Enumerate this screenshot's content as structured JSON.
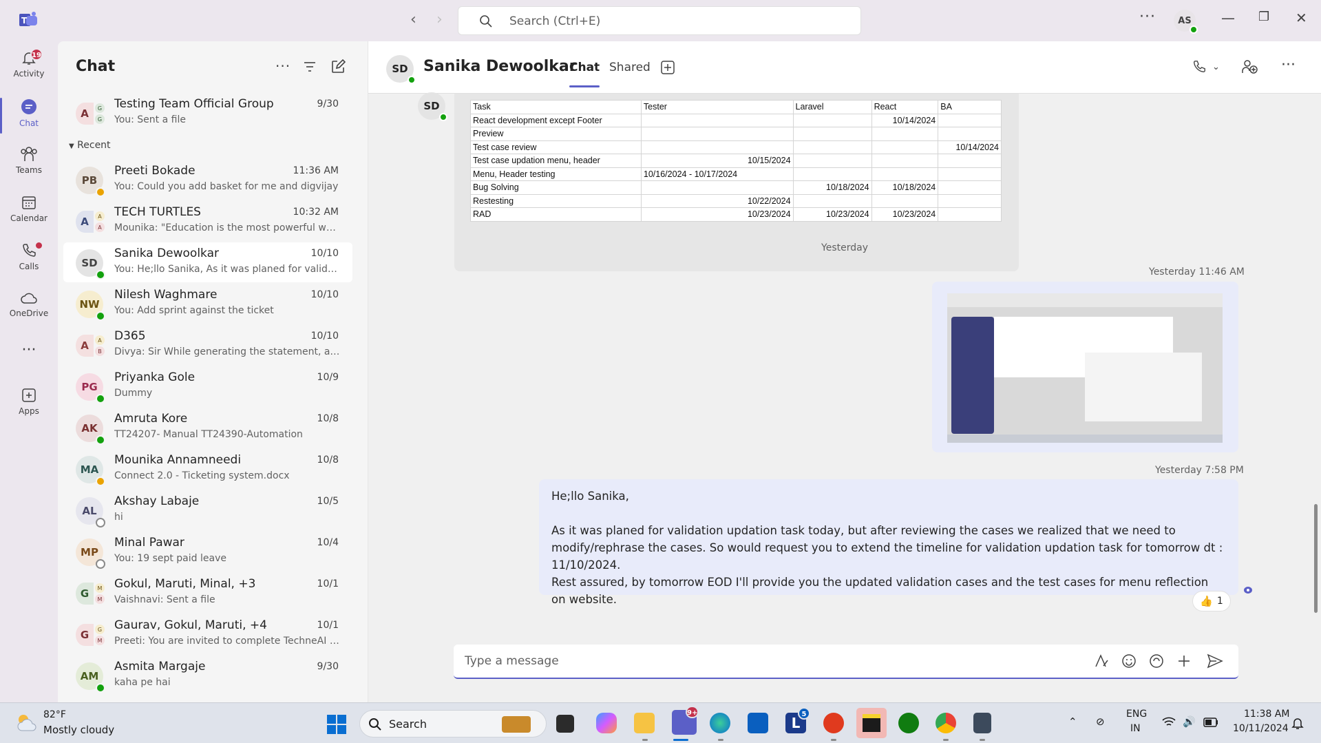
{
  "titlebar": {
    "search_placeholder": "Search (Ctrl+E)",
    "user_initials": "AS"
  },
  "appbar": {
    "items": [
      {
        "label": "Activity",
        "badge": "19"
      },
      {
        "label": "Chat"
      },
      {
        "label": "Teams"
      },
      {
        "label": "Calendar"
      },
      {
        "label": "Calls"
      },
      {
        "label": "OneDrive"
      },
      {
        "label": "Apps"
      }
    ]
  },
  "chatlist": {
    "title": "Chat",
    "pinned": {
      "name": "Testing Team Official Group",
      "time": "9/30",
      "preview": "You: Sent a file",
      "initial": "A",
      "sub1": "G",
      "sub2": "G"
    },
    "section_label": "Recent",
    "conversations": [
      {
        "initials": "PB",
        "name": "Preeti Bokade",
        "time": "11:36 AM",
        "preview": "You: Could you add basket for me and digvijay",
        "status": "yellow",
        "bg": "#e8e2dc",
        "fg": "#5c4a3a"
      },
      {
        "initials": "A",
        "name": "TECH TURTLES",
        "time": "10:32 AM",
        "preview": "Mounika: \"Education is the most powerful wea...",
        "group": true,
        "sub1": "A",
        "sub2": "A",
        "bg": "#dfe2ee",
        "fg": "#3b4a7a"
      },
      {
        "initials": "SD",
        "name": "Sanika Dewoolkar",
        "time": "10/10",
        "preview": "You: He;llo Sanika,   As it was planed for validati...",
        "status": "green",
        "bg": "#e4e4e4",
        "fg": "#424242",
        "active": true
      },
      {
        "initials": "NW",
        "name": "Nilesh Waghmare",
        "time": "10/10",
        "preview": "You: Add sprint against the ticket",
        "status": "green",
        "bg": "#f6edcf",
        "fg": "#6b5312"
      },
      {
        "initials": "A",
        "name": "D365",
        "time": "10/10",
        "preview": "Divya: Sir While generating the statement, a sal...",
        "group": true,
        "sub1": "A",
        "sub2": "B",
        "bg": "#f4e0e0",
        "fg": "#8a3b3b"
      },
      {
        "initials": "PG",
        "name": "Priyanka Gole",
        "time": "10/9",
        "preview": "Dummy",
        "status": "green",
        "bg": "#f6dbe3",
        "fg": "#9b2c4f"
      },
      {
        "initials": "AK",
        "name": "Amruta Kore",
        "time": "10/8",
        "preview": "TT24207- Manual TT24390-Automation",
        "status": "green",
        "bg": "#ecdcdc",
        "fg": "#7a3030"
      },
      {
        "initials": "MA",
        "name": "Mounika Annamneedi",
        "time": "10/8",
        "preview": "Connect 2.0 - Ticketing system.docx",
        "status": "yellow",
        "bg": "#dfe7e6",
        "fg": "#2c5550"
      },
      {
        "initials": "AL",
        "name": "Akshay Labaje",
        "time": "10/5",
        "preview": "hi",
        "status": "off",
        "bg": "#e6e6ee",
        "fg": "#4a4a6a"
      },
      {
        "initials": "MP",
        "name": "Minal Pawar",
        "time": "10/4",
        "preview": "You: 19 sept paid leave",
        "status": "off",
        "bg": "#f4e6d8",
        "fg": "#7a4a1a"
      },
      {
        "initials": "G",
        "name": "Gokul, Maruti, Minal, +3",
        "time": "10/1",
        "preview": "Vaishnavi: Sent a file",
        "group": true,
        "sub1": "M",
        "sub2": "M",
        "bg": "#dde8dd",
        "fg": "#2f5a2f"
      },
      {
        "initials": "G",
        "name": "Gaurav, Gokul, Maruti, +4",
        "time": "10/1",
        "preview": "Preeti: You are invited to complete TechneAI Pv...",
        "group": true,
        "sub1": "G",
        "sub2": "M",
        "bg": "#f4dfe0",
        "fg": "#7a3035"
      },
      {
        "initials": "AM",
        "name": "Asmita Margaje",
        "time": "9/30",
        "preview": "kaha pe hai",
        "status": "green",
        "bg": "#e4ecd8",
        "fg": "#4a6020"
      }
    ]
  },
  "conversation": {
    "contact_initials": "SD",
    "contact_name": "Sanika Dewoolkar",
    "tabs": [
      "Chat",
      "Shared"
    ],
    "table": {
      "headers": [
        "Task",
        "Tester",
        "Laravel",
        "React",
        "BA"
      ],
      "rows": [
        [
          "React development except Footer",
          "",
          "",
          "10/14/2024",
          ""
        ],
        [
          "Preview",
          "",
          "",
          "",
          ""
        ],
        [
          "Test case review",
          "",
          "",
          "",
          "10/14/2024"
        ],
        [
          "Test case updation menu, header",
          "10/15/2024",
          "",
          "",
          ""
        ],
        [
          "Menu, Header testing",
          "10/16/2024 - 10/17/2024",
          "",
          "",
          ""
        ],
        [
          "Bug Solving",
          "",
          "10/18/2024",
          "10/18/2024",
          ""
        ],
        [
          "Restesting",
          "10/22/2024",
          "",
          "",
          ""
        ],
        [
          "RAD",
          "10/23/2024",
          "10/23/2024",
          "10/23/2024",
          ""
        ]
      ]
    },
    "day_divider": "Yesterday",
    "image_time": "Yesterday 11:46 AM",
    "message_time": "Yesterday 7:58 PM",
    "message_lines": [
      "He;llo Sanika,",
      "",
      "As it was planed for validation updation task today, but after reviewing the cases we realized that we need to modify/rephrase the cases. So would request you to extend the timeline for validation updation task for tomorrow dt : 11/10/2024.",
      "Rest assured, by tomorrow EOD I'll provide you the updated validation cases and the test cases for menu reflection on website."
    ],
    "reaction_count": "1",
    "compose_placeholder": "Type a message"
  },
  "taskbar": {
    "weather_temp": "82°F",
    "weather_desc": "Mostly cloudy",
    "search_label": "Search",
    "teams_badge": "9+",
    "app_badge": "5",
    "lang1": "ENG",
    "lang2": "IN",
    "time": "11:38 AM",
    "date": "10/11/2024"
  }
}
